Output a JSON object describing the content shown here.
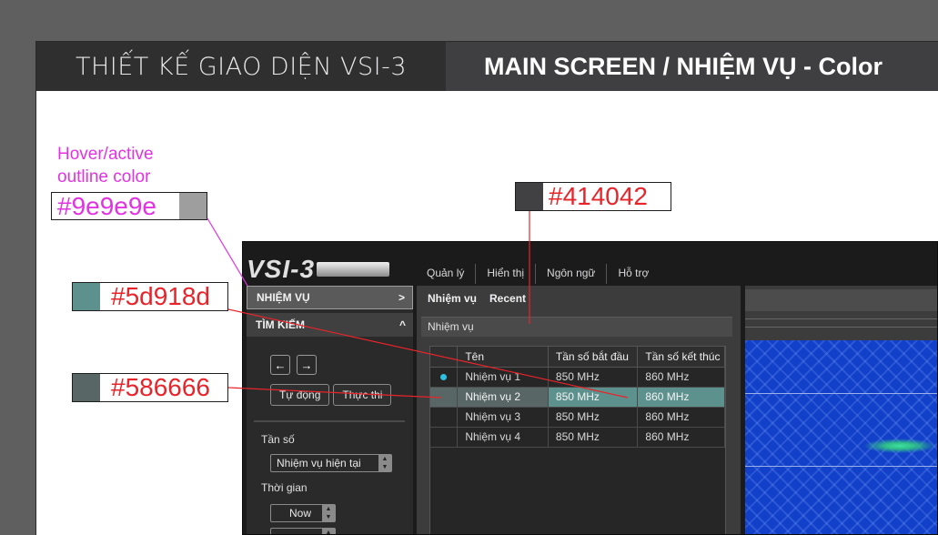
{
  "header": {
    "left_title": "THIẾT KẾ GIAO DIỆN VSI-3",
    "right_title": "MAIN SCREEN / NHIỆM VỤ - Color"
  },
  "annotations": {
    "hover": {
      "label": "Hover/active outline color",
      "hex": "#9e9e9e",
      "color": "#9e9e9e"
    },
    "panel": {
      "hex": "#414042",
      "color": "#414042"
    },
    "active": {
      "hex": "#5d918d",
      "color": "#5d918d"
    },
    "hover_row": {
      "hex": "#586666",
      "color": "#586666"
    }
  },
  "app": {
    "logo": "VSI-3",
    "menu": [
      "Quản lý",
      "Hiển thị",
      "Ngôn ngữ",
      "Hỗ trợ"
    ],
    "sidebar": {
      "nhiem_vu": "NHIỆM VỤ",
      "nhiem_vu_chevron": ">",
      "tim_kiem": "TÌM KIẾM",
      "tim_kiem_chevron": "^",
      "btn_prev": "←",
      "btn_next": "→",
      "btn_auto": "Tự động",
      "btn_exec": "Thực thi",
      "freq_label": "Tần số",
      "freq_value": "Nhiệm vụ hiện tại",
      "time_label": "Thời gian",
      "time_value": "Now"
    },
    "tabs": [
      "Nhiệm vụ",
      "Recent"
    ],
    "section_title": "Nhiệm vụ",
    "table": {
      "columns": [
        "Tên",
        "Tần số bắt đầu",
        "Tần số kết thúc"
      ],
      "rows": [
        {
          "name": "Nhiệm vụ 1",
          "start": "850 MHz",
          "end": "860 MHz",
          "state": "running"
        },
        {
          "name": "Nhiệm vụ 2",
          "start": "850 MHz",
          "end": "860 MHz",
          "state": "active"
        },
        {
          "name": "Nhiệm vụ 3",
          "start": "850 MHz",
          "end": "860 MHz",
          "state": ""
        },
        {
          "name": "Nhiệm vụ 4",
          "start": "850 MHz",
          "end": "860 MHz",
          "state": ""
        }
      ]
    }
  }
}
